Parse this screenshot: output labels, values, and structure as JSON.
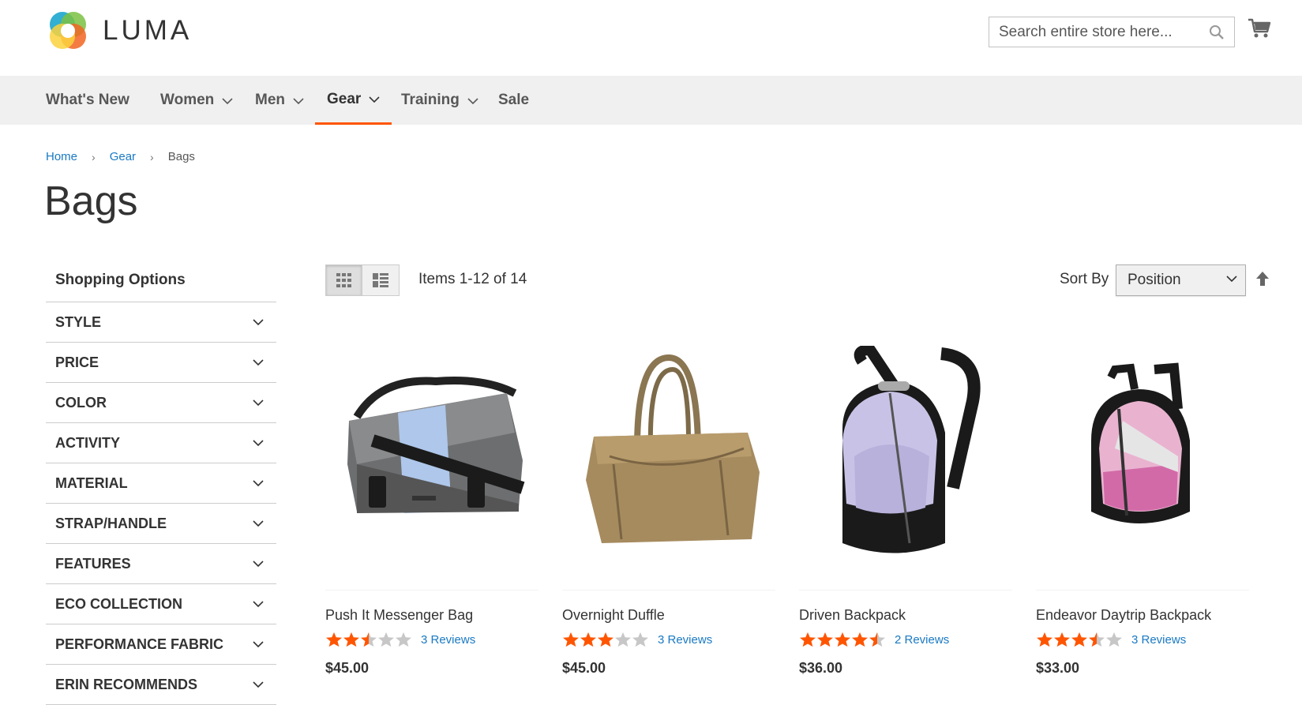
{
  "brand": {
    "name": "LUMA"
  },
  "search": {
    "placeholder": "Search entire store here..."
  },
  "nav": {
    "items": [
      {
        "label": "What's New",
        "has_dropdown": false
      },
      {
        "label": "Women",
        "has_dropdown": true
      },
      {
        "label": "Men",
        "has_dropdown": true
      },
      {
        "label": "Gear",
        "has_dropdown": true,
        "active": true
      },
      {
        "label": "Training",
        "has_dropdown": true
      },
      {
        "label": "Sale",
        "has_dropdown": false
      }
    ]
  },
  "breadcrumb": {
    "home": "Home",
    "gear": "Gear",
    "current": "Bags"
  },
  "page": {
    "title": "Bags"
  },
  "sidebar": {
    "title": "Shopping Options",
    "filters": [
      "STYLE",
      "PRICE",
      "COLOR",
      "ACTIVITY",
      "MATERIAL",
      "STRAP/HANDLE",
      "FEATURES",
      "ECO COLLECTION",
      "PERFORMANCE FABRIC",
      "ERIN RECOMMENDS"
    ]
  },
  "toolbar": {
    "amount": "Items 1-12 of 14",
    "sort_label": "Sort By",
    "sort_value": "Position",
    "view_mode": "grid"
  },
  "products": [
    {
      "name": "Push It Messenger Bag",
      "rating_stars": 2.5,
      "reviews": "3 Reviews",
      "price": "$45.00",
      "image": "messenger-bag"
    },
    {
      "name": "Overnight Duffle",
      "rating_stars": 3,
      "reviews": "3 Reviews",
      "price": "$45.00",
      "image": "duffle-bag"
    },
    {
      "name": "Driven Backpack",
      "rating_stars": 4.5,
      "reviews": "2 Reviews",
      "price": "$36.00",
      "image": "lavender-backpack"
    },
    {
      "name": "Endeavor Daytrip Backpack",
      "rating_stars": 3.5,
      "reviews": "3 Reviews",
      "price": "$33.00",
      "image": "pink-backpack"
    }
  ],
  "colors": {
    "accent": "#ff5501",
    "link": "#1979c3",
    "nav_bg": "#f0f0f0",
    "star_on": "#ff5501",
    "star_off": "#c7c7c7"
  }
}
